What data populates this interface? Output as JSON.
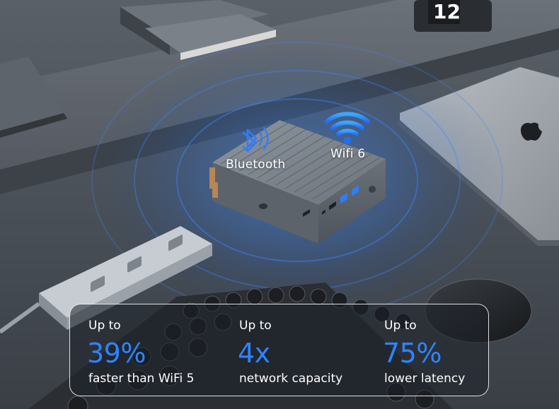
{
  "connectivity": {
    "bluetooth_label": "Bluetooth",
    "wifi_label": "Wifi 6",
    "accent_color": "#2e84ff"
  },
  "stats": [
    {
      "prefix": "Up to",
      "value": "39%",
      "caption": "faster than WiFi 5"
    },
    {
      "prefix": "Up to",
      "value": "4x",
      "caption": "network capacity"
    },
    {
      "prefix": "Up to",
      "value": "75%",
      "caption": "lower latency"
    }
  ]
}
